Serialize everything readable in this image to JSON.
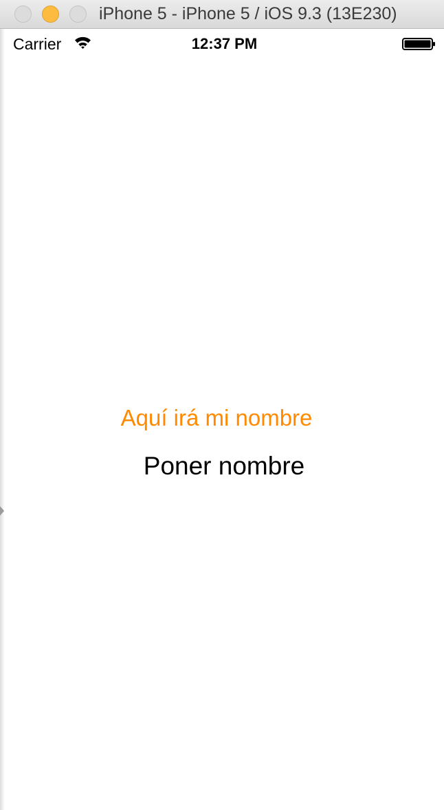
{
  "window": {
    "title": "iPhone 5 - iPhone 5 / iOS 9.3 (13E230)"
  },
  "status_bar": {
    "carrier": "Carrier",
    "time": "12:37 PM",
    "wifi_icon": "wifi-icon",
    "battery_icon": "battery-full-icon"
  },
  "content": {
    "name_label": "Aquí irá mi nombre",
    "set_name_button": "Poner nombre"
  },
  "colors": {
    "label_accent": "#ff8a00",
    "minimize_button": "#fdbc40",
    "background": "#ffffff"
  }
}
